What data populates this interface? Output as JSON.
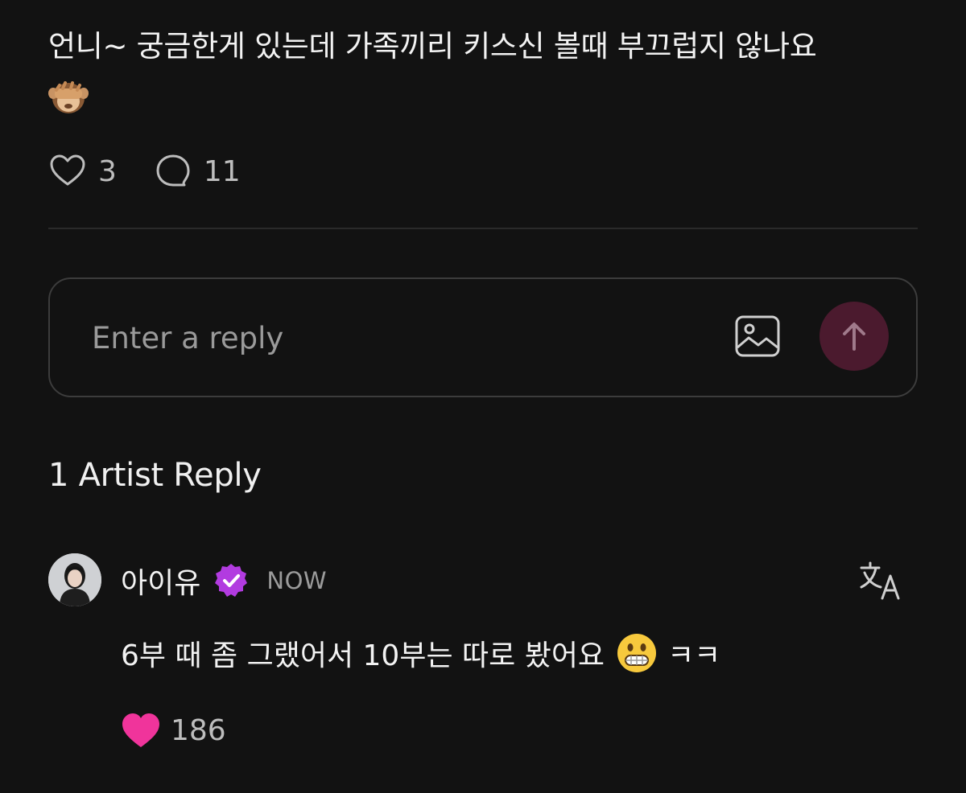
{
  "post": {
    "text": "언니~ 궁금한게 있는데 가족끼리 키스신 볼때 부끄럽지 않나요",
    "emoji": "see-no-evil-monkey",
    "like_count": "3",
    "comment_count": "11"
  },
  "reply_box": {
    "placeholder": "Enter a reply",
    "send_button_color": "#4b1a2e"
  },
  "artist_replies": {
    "title": "1 Artist Reply",
    "items": [
      {
        "name": "아이유",
        "verified": true,
        "verified_color": "#b23be0",
        "timestamp": "NOW",
        "text": "6부 때 좀 그랬어서 10부는 따로 봤어요",
        "emoji": "grimacing-face",
        "text_suffix": "ㅋㅋ",
        "like_count": "186",
        "liked": true,
        "like_color": "#f0349b"
      }
    ]
  }
}
